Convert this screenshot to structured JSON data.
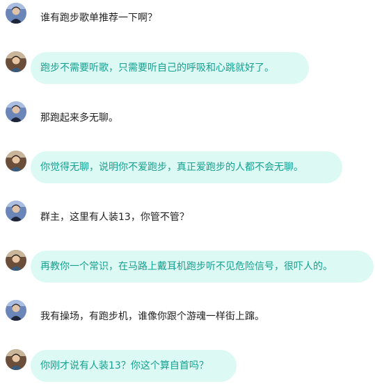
{
  "messages": [
    {
      "type": "plain",
      "avatar": "avatar-a",
      "text": "谁有跑步歌单推荐一下啊？"
    },
    {
      "type": "bubble",
      "avatar": "avatar-b",
      "text": "跑步不需要听歌，只需要听自己的呼吸和心跳就好了。"
    },
    {
      "type": "plain",
      "avatar": "avatar-a",
      "text": "那跑起来多无聊。"
    },
    {
      "type": "bubble",
      "avatar": "avatar-b",
      "text": "你觉得无聊，说明你不爱跑步，真正爱跑步的人都不会无聊。"
    },
    {
      "type": "plain",
      "avatar": "avatar-a",
      "text": "群主，这里有人装13，你管不管？"
    },
    {
      "type": "bubble",
      "avatar": "avatar-b",
      "text": "再教你一个常识，在马路上戴耳机跑步听不见危险信号，很吓人的。"
    },
    {
      "type": "plain",
      "avatar": "avatar-a",
      "text": "我有操场，有跑步机，谁像你跟个游魂一样街上蹿。"
    },
    {
      "type": "bubble",
      "avatar": "avatar-b",
      "text": "你刚才说有人装13？你这个算自首吗？"
    }
  ],
  "colors": {
    "bubble_bg": "#dcfaf3",
    "bubble_text": "#14a090",
    "plain_text": "#222222"
  }
}
